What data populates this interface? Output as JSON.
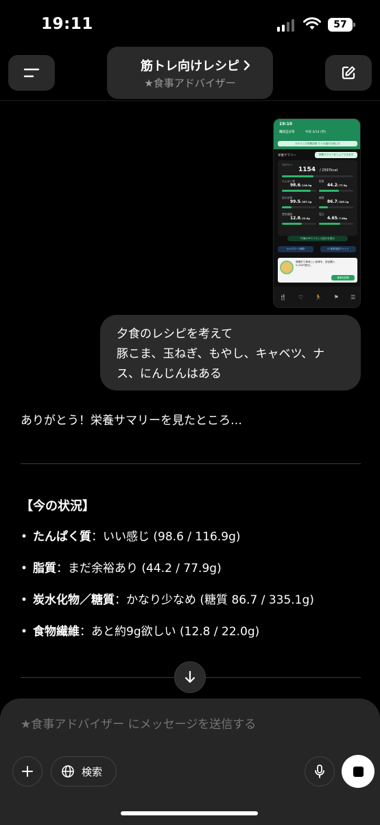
{
  "status": {
    "time": "19:11",
    "battery": "57"
  },
  "header": {
    "title": "筋トレ向けレシピ",
    "subtitle": "★食事アドバイザー",
    "menu_icon": "menu-icon",
    "edit_icon": "edit-icon"
  },
  "attachment": {
    "time": "19:10",
    "date_label": "購読自分等",
    "date_today": "今日 4/14 (月)",
    "banner": "カロリとの栄養記録 ろつの運行お使い方",
    "section_title": "栄養サマリー",
    "share_label": "栄養サマリーをシェアできます",
    "calorie_label": "カロリー",
    "calorie_value": "1154",
    "calorie_target": "/ 2597kcal",
    "nutrients": [
      {
        "label": "たんぱく質",
        "value": "98.6",
        "target": "/ 116.9g",
        "ratio": 0.84
      },
      {
        "label": "脂質",
        "value": "44.2",
        "target": "/ 77.9g",
        "ratio": 0.57
      },
      {
        "label": "炭水化物",
        "value": "99.5",
        "target": "/ 357.1g",
        "ratio": 0.28
      },
      {
        "label": "糖質",
        "value": "86.7",
        "target": "/ 335.1g",
        "ratio": 0.26
      },
      {
        "label": "食物繊維",
        "value": "12.8",
        "target": "/ 22.0g",
        "ratio": 0.58
      },
      {
        "label": "塩分",
        "value": "4.65",
        "target": "/ 7.60g",
        "ratio": 0.61
      }
    ],
    "pfc_button": "円滑のPFCバランス成分を表示",
    "btn_camera": "カメラロール解析",
    "btn_ai": "AI 食事相談チャット",
    "ad_text": "健康的で美味しい食事を。部品購入5,000円割引。",
    "ad_button": "食事を記録"
  },
  "user_message": {
    "lines": [
      "夕食のレシピを考えて",
      "豚こま、玉ねぎ、もやし、キャベツ、ナ",
      "ス、にんじんはある"
    ]
  },
  "assistant": {
    "intro": "ありがとう！栄養サマリーを見たところ…",
    "section_title": "【今の状況】",
    "items": [
      {
        "label": "たんぱく質",
        "text": "：いい感じ (98.6 / 116.9g)"
      },
      {
        "label": "脂質",
        "text": "：まだ余裕あり (44.2 / 77.9g)"
      },
      {
        "label": "炭水化物／糖質",
        "text": "：かなり少なめ (糖質 86.7 / 335.1g)"
      },
      {
        "label": "食物繊維",
        "text": "：あと約9g欲しい (12.8 / 22.0g)"
      }
    ]
  },
  "composer": {
    "placeholder": "★食事アドバイザー にメッセージを送信する",
    "search_label": "検索"
  }
}
